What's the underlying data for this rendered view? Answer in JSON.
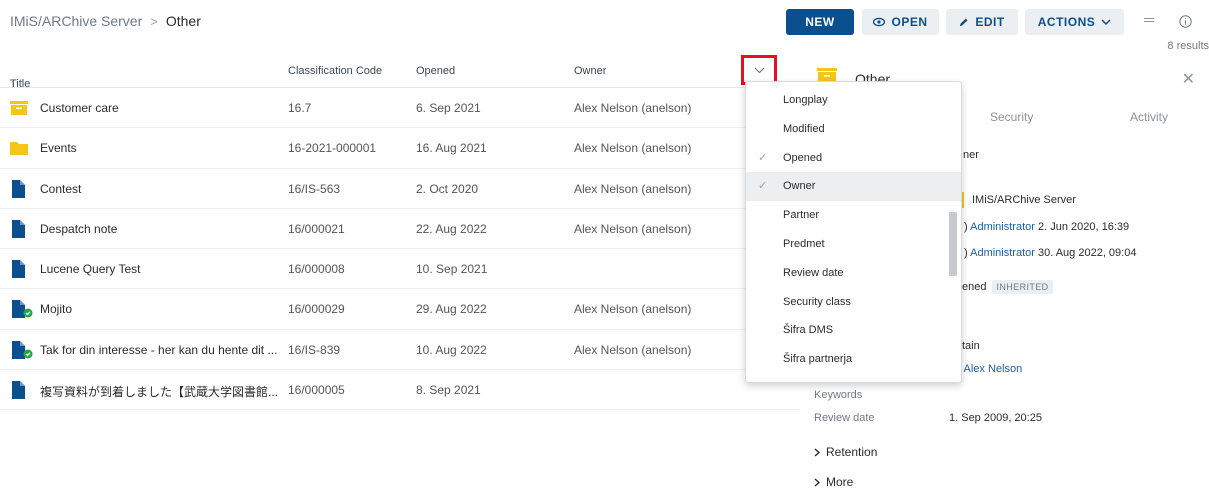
{
  "breadcrumb": {
    "root": "IMiS/ARChive Server",
    "separator": ">",
    "current": "Other"
  },
  "toolbar": {
    "new_label": "NEW",
    "open_label": "OPEN",
    "edit_label": "EDIT",
    "actions_label": "ACTIONS",
    "results": "8 results"
  },
  "table": {
    "headers": {
      "title": "Title",
      "sort_indicator": "↑",
      "code": "Classification Code",
      "opened": "Opened",
      "owner": "Owner"
    },
    "rows": [
      {
        "icon": "box-folder-icon",
        "title": "Customer care",
        "code": "16.7",
        "opened": "6. Sep 2021",
        "owner": "Alex Nelson (anelson)"
      },
      {
        "icon": "folder-icon",
        "title": "Events",
        "code": "16-2021-000001",
        "opened": "16. Aug 2021",
        "owner": "Alex Nelson (anelson)"
      },
      {
        "icon": "document-icon",
        "title": "Contest",
        "code": "16/IS-563",
        "opened": "2. Oct 2020",
        "owner": "Alex Nelson (anelson)"
      },
      {
        "icon": "document-icon",
        "title": "Despatch note",
        "code": "16/000021",
        "opened": "22. Aug 2022",
        "owner": "Alex Nelson (anelson)"
      },
      {
        "icon": "document-icon",
        "title": "Lucene Query Test",
        "code": "16/000008",
        "opened": "10. Sep 2021",
        "owner": ""
      },
      {
        "icon": "document-check-icon",
        "title": "Mojito",
        "code": "16/000029",
        "opened": "29. Aug 2022",
        "owner": "Alex Nelson (anelson)"
      },
      {
        "icon": "document-check-icon",
        "title": "Tak for din interesse - her kan du hente dit ...",
        "code": "16/IS-839",
        "opened": "10. Aug 2022",
        "owner": "Alex Nelson (anelson)"
      },
      {
        "icon": "document-icon",
        "title": "複写資料が到着しました【武蔵大学図書館...",
        "code": "16/000005",
        "opened": "8. Sep 2021",
        "owner": ""
      }
    ]
  },
  "column_menu": {
    "items": [
      {
        "label": "Longplay",
        "checked": false
      },
      {
        "label": "Modified",
        "checked": false
      },
      {
        "label": "Opened",
        "checked": true
      },
      {
        "label": "Owner",
        "checked": true,
        "active": true
      },
      {
        "label": "Partner",
        "checked": false
      },
      {
        "label": "Predmet",
        "checked": false
      },
      {
        "label": "Review date",
        "checked": false
      },
      {
        "label": "Security class",
        "checked": false
      },
      {
        "label": "Šifra DMS",
        "checked": false
      },
      {
        "label": "Šifra partnerja",
        "checked": false
      }
    ]
  },
  "panel": {
    "title": "Other",
    "tabs": {
      "security": "Security",
      "activity": "Activity"
    },
    "owner_fragment": "ner",
    "location": "IMiS/ARChive Server",
    "created_by": "Administrator",
    "created_at": "2. Jun 2020, 16:39",
    "modified_by": "Administrator",
    "modified_at": "30. Aug 2022, 09:04",
    "status_fragment": "ened",
    "status_badge": "INHERITED",
    "retain_fragment": "tain",
    "person": "Alex Nelson",
    "keywords_label": "Keywords",
    "review_label": "Review date",
    "review_value": "1. Sep 2009, 20:25",
    "retention_label": "Retention",
    "more_label": "More"
  },
  "colors": {
    "primary": "#0b4f8c",
    "folder": "#f5c518",
    "document": "#0b4f8c",
    "check": "#22a645",
    "highlight": "#e0151b"
  }
}
